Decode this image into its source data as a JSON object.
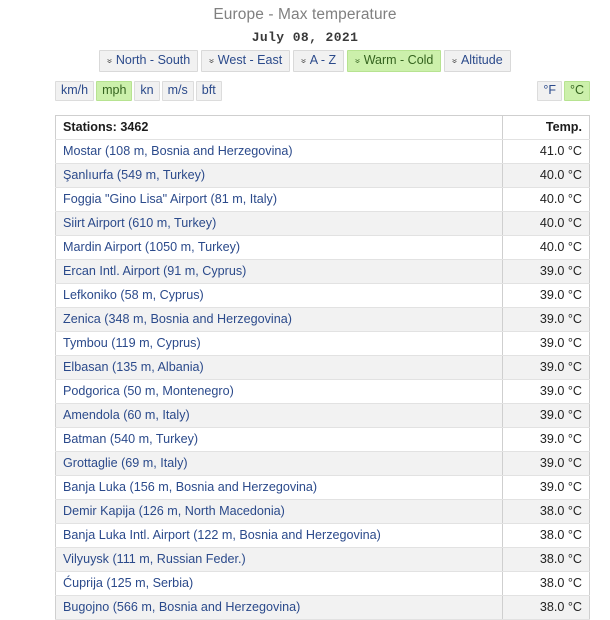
{
  "header": {
    "title": "Europe - Max temperature",
    "date": "July 08, 2021"
  },
  "sort_bar": {
    "chevron_icon": "»",
    "buttons": [
      {
        "label": "North - South",
        "active": false
      },
      {
        "label": "West - East",
        "active": false
      },
      {
        "label": "A - Z",
        "active": false
      },
      {
        "label": "Warm - Cold",
        "active": true
      },
      {
        "label": "Altitude",
        "active": false
      }
    ]
  },
  "unit_bar": {
    "speed_units": [
      {
        "label": "km/h",
        "active": false
      },
      {
        "label": "mph",
        "active": true
      },
      {
        "label": "kn",
        "active": false
      },
      {
        "label": "m/s",
        "active": false
      },
      {
        "label": "bft",
        "active": false
      }
    ],
    "temperature_units": [
      {
        "label": "°F",
        "active": false
      },
      {
        "label": "°C",
        "active": true
      }
    ]
  },
  "table": {
    "columns": {
      "station": "Stations: 3462",
      "temperature": "Temp."
    },
    "station_count": 3462,
    "rows": [
      {
        "station": "Mostar (108 m, Bosnia and Herzegovina)",
        "temp": "41.0 °C"
      },
      {
        "station": "Şanlıurfa (549 m, Turkey)",
        "temp": "40.0 °C"
      },
      {
        "station": "Foggia \"Gino Lisa\" Airport (81 m, Italy)",
        "temp": "40.0 °C"
      },
      {
        "station": "Siirt Airport (610 m, Turkey)",
        "temp": "40.0 °C"
      },
      {
        "station": "Mardin Airport (1050 m, Turkey)",
        "temp": "40.0 °C"
      },
      {
        "station": "Ercan Intl. Airport (91 m, Cyprus)",
        "temp": "39.0 °C"
      },
      {
        "station": "Lefkoniko (58 m, Cyprus)",
        "temp": "39.0 °C"
      },
      {
        "station": "Zenica (348 m, Bosnia and Herzegovina)",
        "temp": "39.0 °C"
      },
      {
        "station": "Tymbou (119 m, Cyprus)",
        "temp": "39.0 °C"
      },
      {
        "station": "Elbasan (135 m, Albania)",
        "temp": "39.0 °C"
      },
      {
        "station": "Podgorica (50 m, Montenegro)",
        "temp": "39.0 °C"
      },
      {
        "station": "Amendola (60 m, Italy)",
        "temp": "39.0 °C"
      },
      {
        "station": "Batman (540 m, Turkey)",
        "temp": "39.0 °C"
      },
      {
        "station": "Grottaglie (69 m, Italy)",
        "temp": "39.0 °C"
      },
      {
        "station": "Banja Luka (156 m, Bosnia and Herzegovina)",
        "temp": "39.0 °C"
      },
      {
        "station": "Demir Kapija (126 m, North Macedonia)",
        "temp": "38.0 °C"
      },
      {
        "station": "Banja Luka Intl. Airport (122 m, Bosnia and Herzegovina)",
        "temp": "38.0 °C"
      },
      {
        "station": "Vilyuysk (111 m, Russian Feder.)",
        "temp": "38.0 °C"
      },
      {
        "station": "Ćuprija (125 m, Serbia)",
        "temp": "38.0 °C"
      },
      {
        "station": "Bugojno (566 m, Bosnia and Herzegovina)",
        "temp": "38.0 °C"
      }
    ]
  },
  "colors": {
    "accent_green_bg": "#ccf0ab",
    "accent_green_text": "#35641f",
    "link_blue": "#2b4a8b",
    "title_gray": "#808080",
    "row_stripe": "#f2f2f2"
  }
}
